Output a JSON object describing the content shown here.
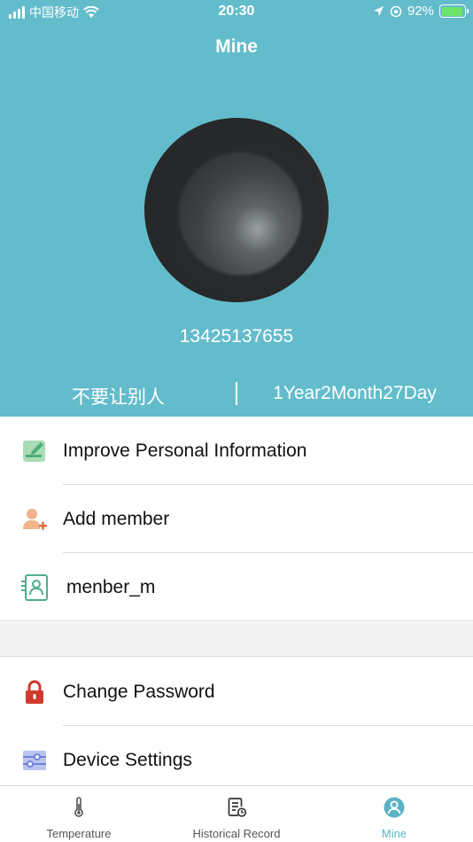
{
  "status_bar": {
    "carrier": "中国移动",
    "time": "20:30",
    "battery_percent": "92%",
    "battery_level": 0.92
  },
  "header": {
    "title": "Mine",
    "phone": "13425137655",
    "member_name": "不要让别人",
    "age": "1Year2Month27Day",
    "background_color": "#63bccb"
  },
  "menu_group_1": [
    {
      "label": "Improve Personal Information",
      "icon": "edit-profile-icon"
    },
    {
      "label": "Add member",
      "icon": "add-member-icon"
    },
    {
      "label": "menber_m",
      "icon": "member-card-icon"
    }
  ],
  "menu_group_2": [
    {
      "label": "Change Password",
      "icon": "lock-icon"
    },
    {
      "label": "Device Settings",
      "icon": "device-settings-icon"
    }
  ],
  "tabs": [
    {
      "label": "Temperature",
      "icon": "thermometer-icon",
      "active": false
    },
    {
      "label": "Historical Record",
      "icon": "history-record-icon",
      "active": false
    },
    {
      "label": "Mine",
      "icon": "person-icon",
      "active": true
    }
  ],
  "colors": {
    "accent": "#5bb3c4",
    "lock_red": "#d0392b",
    "member_green": "#4fae8c"
  }
}
